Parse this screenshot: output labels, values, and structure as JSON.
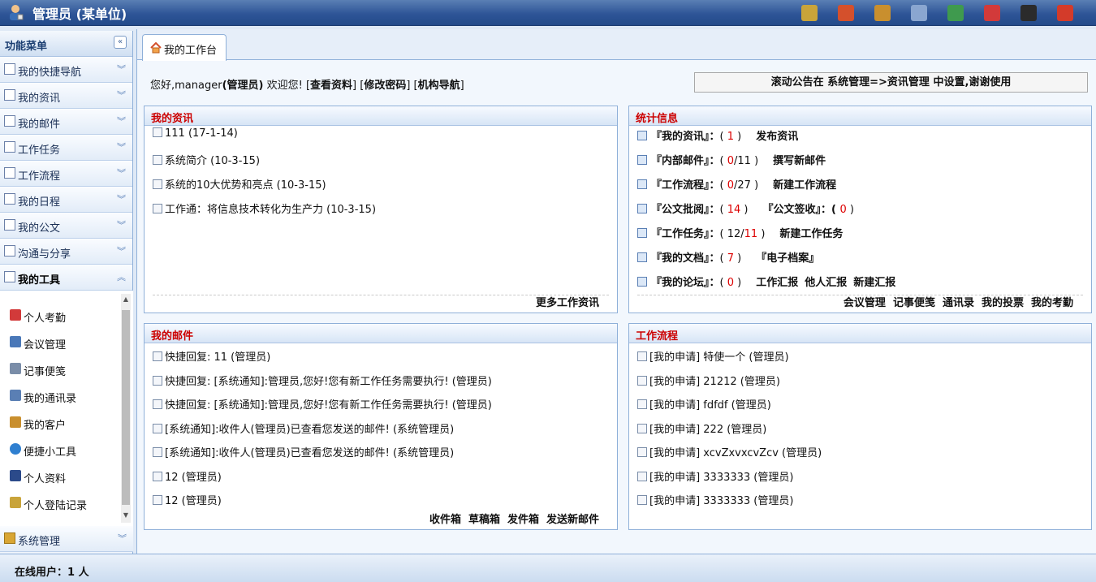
{
  "app": {
    "title": "管理员 (某单位)"
  },
  "top_icons": [
    {
      "icon": "notebook-edit-icon",
      "color": "#c9a43a"
    },
    {
      "icon": "home-icon",
      "color": "#d4502c"
    },
    {
      "icon": "clipboard-icon",
      "color": "#c98f2e"
    },
    {
      "icon": "mail-icon",
      "color": "#8aa6d0"
    },
    {
      "icon": "door-exit-icon",
      "color": "#3f9a4e"
    },
    {
      "icon": "calendar-icon",
      "color": "#d23a3a"
    },
    {
      "icon": "user-admin-icon",
      "color": "#2b2b2b"
    },
    {
      "icon": "power-icon",
      "color": "#d33b2a"
    }
  ],
  "sidebar": {
    "header": "功能菜单",
    "menus": [
      {
        "label": "我的快捷导航",
        "icon": "quick-nav-icon"
      },
      {
        "label": "我的资讯",
        "icon": "news-icon"
      },
      {
        "label": "我的邮件",
        "icon": "mail-icon"
      },
      {
        "label": "工作任务",
        "icon": "task-book-icon"
      },
      {
        "label": "工作流程",
        "icon": "workflow-icon"
      },
      {
        "label": "我的日程",
        "icon": "calendar-icon"
      },
      {
        "label": "我的公文",
        "icon": "document-icon"
      },
      {
        "label": "沟通与分享",
        "icon": "share-icon"
      },
      {
        "label": "我的工具",
        "icon": "tools-icon"
      }
    ],
    "tools": [
      {
        "label": "个人考勤",
        "icon": "attendance-icon",
        "color": "#d23a3a"
      },
      {
        "label": "会议管理",
        "icon": "meeting-book-icon",
        "color": "#4a78b8"
      },
      {
        "label": "记事便笺",
        "icon": "memo-icon",
        "color": "#7a8da8"
      },
      {
        "label": "我的通讯录",
        "icon": "address-book-icon",
        "color": "#5a7fb4"
      },
      {
        "label": "我的客户",
        "icon": "customer-icon",
        "color": "#c98f2e"
      },
      {
        "label": "便捷小工具",
        "icon": "globe-icon",
        "color": "#2f7fd0"
      },
      {
        "label": "个人资料",
        "icon": "profile-icon",
        "color": "#2b4a8a"
      },
      {
        "label": "个人登陆记录",
        "icon": "login-record-icon",
        "color": "#c9a43a"
      }
    ],
    "system": {
      "label": "系统管理",
      "icon": "system-icon"
    }
  },
  "tab": {
    "label": "我的工作台"
  },
  "welcome": {
    "greeting": "您好,manager",
    "role": "(管理员)",
    "text": " 欢迎您! ",
    "links": [
      "查看资料",
      "修改密码",
      "机构导航"
    ]
  },
  "notice": "滚动公告在 系统管理=>资讯管理 中设置,谢谢使用",
  "news": {
    "title": "我的资讯",
    "items": [
      {
        "text": "111 (17-1-14)"
      },
      {
        "text": "系统简介 (10-3-15)"
      },
      {
        "text": "系统的10大优势和亮点 (10-3-15)"
      },
      {
        "text": "工作通：将信息技术转化为生产力 (10-3-15)"
      }
    ],
    "more": "更多工作资讯"
  },
  "stats": {
    "title": "统计信息",
    "rows": [
      {
        "label": "『我的资讯』：",
        "open": "( ",
        "red": "1",
        "tail": " )",
        "links": [
          "发布资讯"
        ]
      },
      {
        "label": "『内部邮件』：",
        "open": "( ",
        "red": "0",
        "tail": "/11 )",
        "links": [
          "撰写新邮件"
        ]
      },
      {
        "label": "『工作流程』：",
        "open": "( ",
        "red": "0",
        "tail": "/27 )",
        "links": [
          "新建工作流程"
        ]
      },
      {
        "label": "『公文批阅』：",
        "open": "( ",
        "red": "14",
        "tail": " )",
        "links": [
          "『公文签收』：( ",
          "0",
          " )"
        ]
      },
      {
        "label": "『工作任务』：",
        "open": "( 12/",
        "red": "11",
        "tail": " )",
        "links": [
          "新建工作任务"
        ]
      },
      {
        "label": "『我的文档』：",
        "open": "( ",
        "red": "7",
        "tail": " )",
        "links": [
          "『电子档案』"
        ]
      },
      {
        "label": "『我的论坛』：",
        "open": "( ",
        "red": "0",
        "tail": " )",
        "links": [
          "工作汇报",
          "他人汇报",
          "新建汇报"
        ]
      }
    ],
    "footer": [
      "会议管理",
      "记事便笺",
      "通讯录",
      "我的投票",
      "我的考勤"
    ]
  },
  "mail": {
    "title": "我的邮件",
    "items": [
      "快捷回复: 11 (管理员)",
      "快捷回复: [系统通知]:管理员,您好!您有新工作任务需要执行! (管理员)",
      "快捷回复: [系统通知]:管理员,您好!您有新工作任务需要执行! (管理员)",
      "[系统通知]:收件人(管理员)已查看您发送的邮件! (系统管理员)",
      "[系统通知]:收件人(管理员)已查看您发送的邮件! (系统管理员)",
      "12 (管理员)",
      "12 (管理员)"
    ],
    "footer": [
      "收件箱",
      "草稿箱",
      "发件箱",
      "发送新邮件"
    ]
  },
  "workflow": {
    "title": "工作流程",
    "items": [
      "[我的申请] 特使一个 (管理员)",
      "[我的申请] 21212 (管理员)",
      "[我的申请] fdfdf (管理员)",
      "[我的申请] 222 (管理员)",
      "[我的申请] xcvZxvxcvZcv (管理员)",
      "[我的申请] 3333333 (管理员)",
      "[我的申请] 3333333 (管理员)"
    ]
  },
  "status": {
    "online": "在线用户：1 人"
  }
}
